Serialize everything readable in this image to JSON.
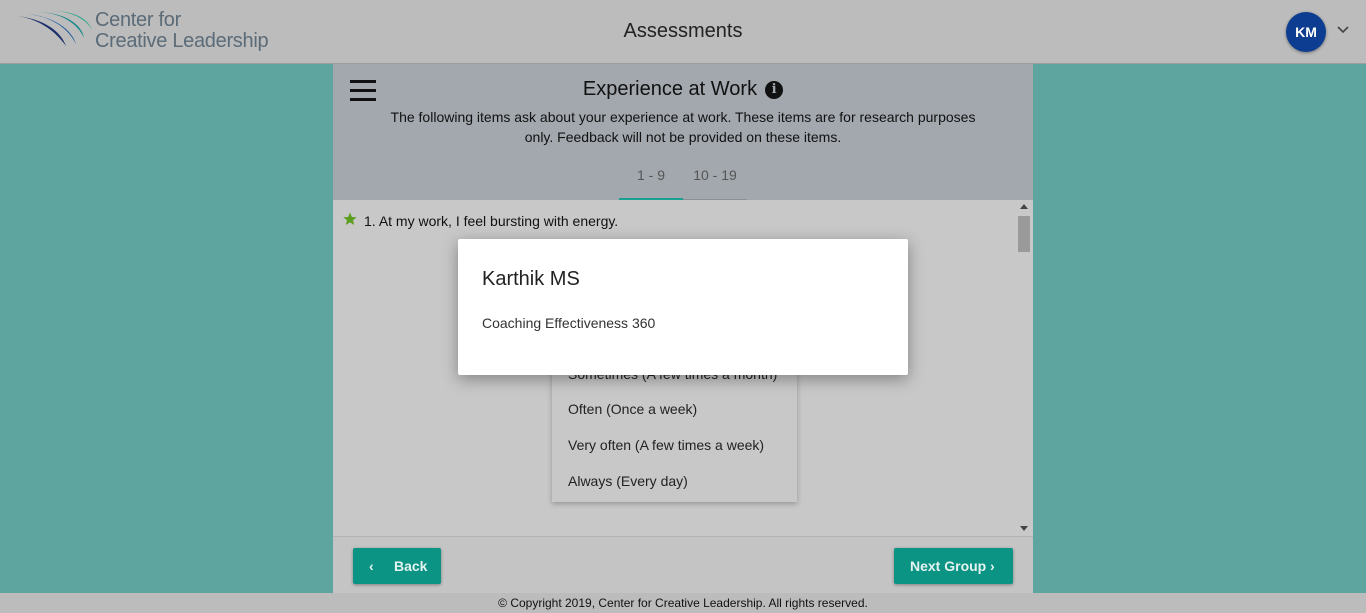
{
  "header": {
    "logo_line1": "Center for",
    "logo_line2": "Creative Leadership",
    "title": "Assessments",
    "avatar_initials": "KM",
    "avatar_color": "#0c3d91",
    "menu_icon": "chevron-down-icon"
  },
  "section": {
    "title": "Experience at Work",
    "info_icon": "info-icon",
    "info_glyph": "i",
    "description": "The following items ask about your experience at work. These items are for research purposes only. Feedback will not be provided on these items.",
    "tabs": [
      {
        "label": "1 - 9",
        "active": true
      },
      {
        "label": "10 - 19",
        "active": false
      }
    ]
  },
  "question": {
    "number_text": "1.",
    "text": "At my work, I feel bursting with energy.",
    "icon": "star-icon"
  },
  "dropdown": {
    "options": [
      "Sometimes (A few times a month)",
      "Often (Once a week)",
      "Very often (A few times a week)",
      "Always (Every day)"
    ]
  },
  "buttons": {
    "back_label": "Back",
    "next_label": "Next Group",
    "back_chevron": "‹",
    "next_chevron": "›"
  },
  "footer": {
    "copyright": "© Copyright 2019, Center for Creative Leadership. All rights reserved."
  },
  "modal": {
    "title": "Karthik MS",
    "subtitle": "Coaching Effectiveness 360"
  },
  "colors": {
    "background": "#5fa59f",
    "accent": "#0b9484",
    "tab_active": "#18a08e"
  }
}
